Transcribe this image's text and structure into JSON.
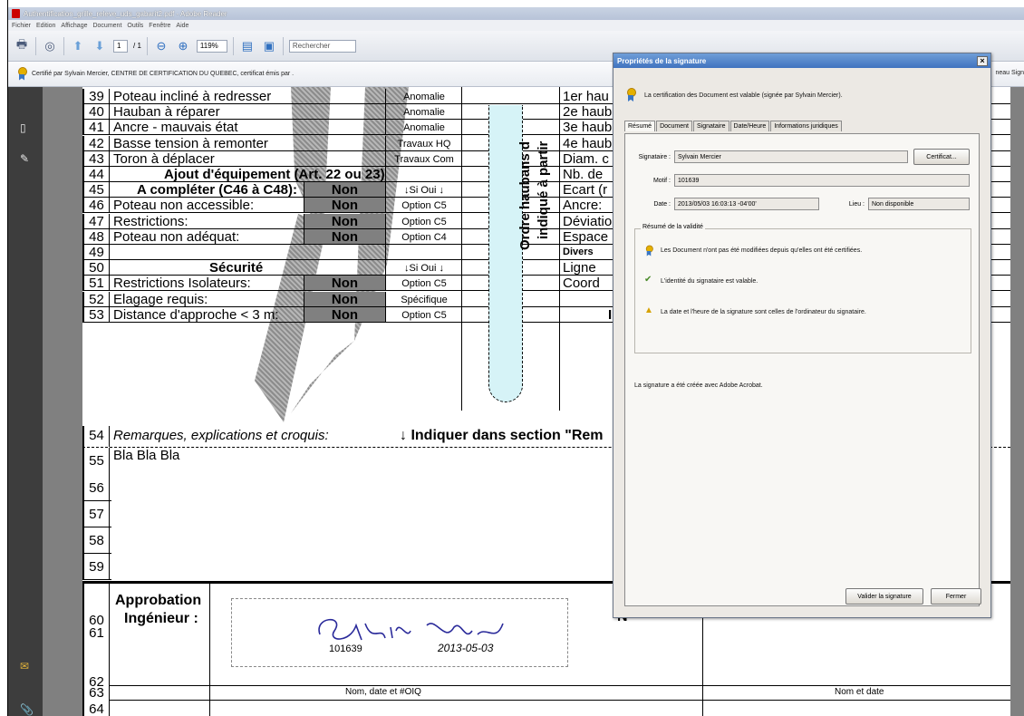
{
  "window": {
    "title": "Authentification_grille_releve_uds_gabarit2.pdf - Adobe Reader",
    "menu": [
      "Fichier",
      "Edition",
      "Affichage",
      "Document",
      "Outils",
      "Fenêtre",
      "Aide"
    ]
  },
  "toolbar": {
    "page_current": "1",
    "page_total": "/ 1",
    "zoom": "119%",
    "search_placeholder": "Rechercher"
  },
  "certbar": {
    "text": "Certifié par Sylvain Mercier, CENTRE DE CERTIFICATION DU QUEBEC, certificat émis par .",
    "right_panel": "neau Sign"
  },
  "form": {
    "rows": [
      {
        "n": "39",
        "label": "Poteau incliné à redresser",
        "status": "Anomalie",
        "right": "1er hau"
      },
      {
        "n": "40",
        "label": "Hauban à réparer",
        "status": "Anomalie",
        "right": "2e haub"
      },
      {
        "n": "41",
        "label": "Ancre - mauvais état",
        "status": "Anomalie",
        "right": "3e haub"
      },
      {
        "n": "42",
        "label": "Basse tension à remonter",
        "status": "Travaux HQ",
        "right": "4e haub"
      },
      {
        "n": "43",
        "label": "Toron à déplacer",
        "status": "Travaux Com",
        "right": "Diam. c"
      },
      {
        "n": "44",
        "label": "Ajout d'équipement (Art. 22 ou 23)",
        "status": "",
        "right": "Nb. de"
      },
      {
        "n": "45",
        "label": "A compléter (C46 à C48):",
        "value": "Non",
        "status": "↓Si Oui ↓",
        "right": "Ecart (r"
      },
      {
        "n": "46",
        "label": "Poteau non accessible:",
        "value": "Non",
        "status": "Option C5",
        "right": "Ancre:"
      },
      {
        "n": "47",
        "label": "Restrictions:",
        "value": "Non",
        "status": "Option C5",
        "right": "Déviatio"
      },
      {
        "n": "48",
        "label": "Poteau non adéquat:",
        "value": "Non",
        "status": "Option C4",
        "right": "Espace"
      },
      {
        "n": "49",
        "label": "",
        "status": "",
        "right": "Divers"
      },
      {
        "n": "50",
        "label": "Sécurité",
        "status": "↓Si Oui ↓",
        "right": "Ligne"
      },
      {
        "n": "51",
        "label": "Restrictions Isolateurs:",
        "value": "Non",
        "status": "Option C5",
        "right": "Coord"
      },
      {
        "n": "52",
        "label": "Elagage requis:",
        "value": "Non",
        "status": "Spécifique",
        "right": ""
      },
      {
        "n": "53",
        "label": "Distance d'approche < 3 m:",
        "value": "Non",
        "status": "Option C5",
        "right": "Inc"
      }
    ],
    "vertical_text_1": "Ordre haubans d",
    "vertical_text_2": "indiqué à partir",
    "row54": {
      "n": "54",
      "label": "Remarques, explications et croquis:",
      "right": "↓ Indiquer dans section \"Rem"
    },
    "row55": {
      "n": "55",
      "label": "Bla Bla Bla"
    },
    "blank_rows": [
      "56",
      "57",
      "58",
      "59"
    ],
    "approval": {
      "n1": "60",
      "n2": "61",
      "n3": "62",
      "n4": "63",
      "n5": "64",
      "label1": "Approbation",
      "label2": "Ingénieur :",
      "sig_number": "101639",
      "sig_date": "2013-05-03",
      "sig_caption": "Nom, date et #OIQ",
      "right_caption": "Nom et date",
      "right_letter": "N"
    }
  },
  "dialog": {
    "title": "Propriétés de la signature",
    "summary": "La certification des Document est valable (signée par Sylvain Mercier).",
    "tabs": [
      "Résumé",
      "Document",
      "Signataire",
      "Date/Heure",
      "Informations juridiques"
    ],
    "signataire_label": "Signataire :",
    "signataire_value": "Sylvain Mercier",
    "certificat_button": "Certificat...",
    "motif_label": "Motif :",
    "motif_value": "101639",
    "date_label": "Date :",
    "date_value": "2013/05/03 16:03:13 -04'00'",
    "lieu_label": "Lieu :",
    "lieu_value": "Non disponible",
    "validity_title": "Résumé de la validité",
    "validity_1": "Les Document n'ont pas été modifiées depuis qu'elles ont été certifiées.",
    "validity_2": "L'identité du signataire est valable.",
    "validity_3": "La date et l'heure de la signature sont celles de l'ordinateur du signataire.",
    "created_with": "La signature a été créée avec Adobe Acrobat.",
    "validate_button": "Valider la signature",
    "close_button": "Fermer"
  }
}
